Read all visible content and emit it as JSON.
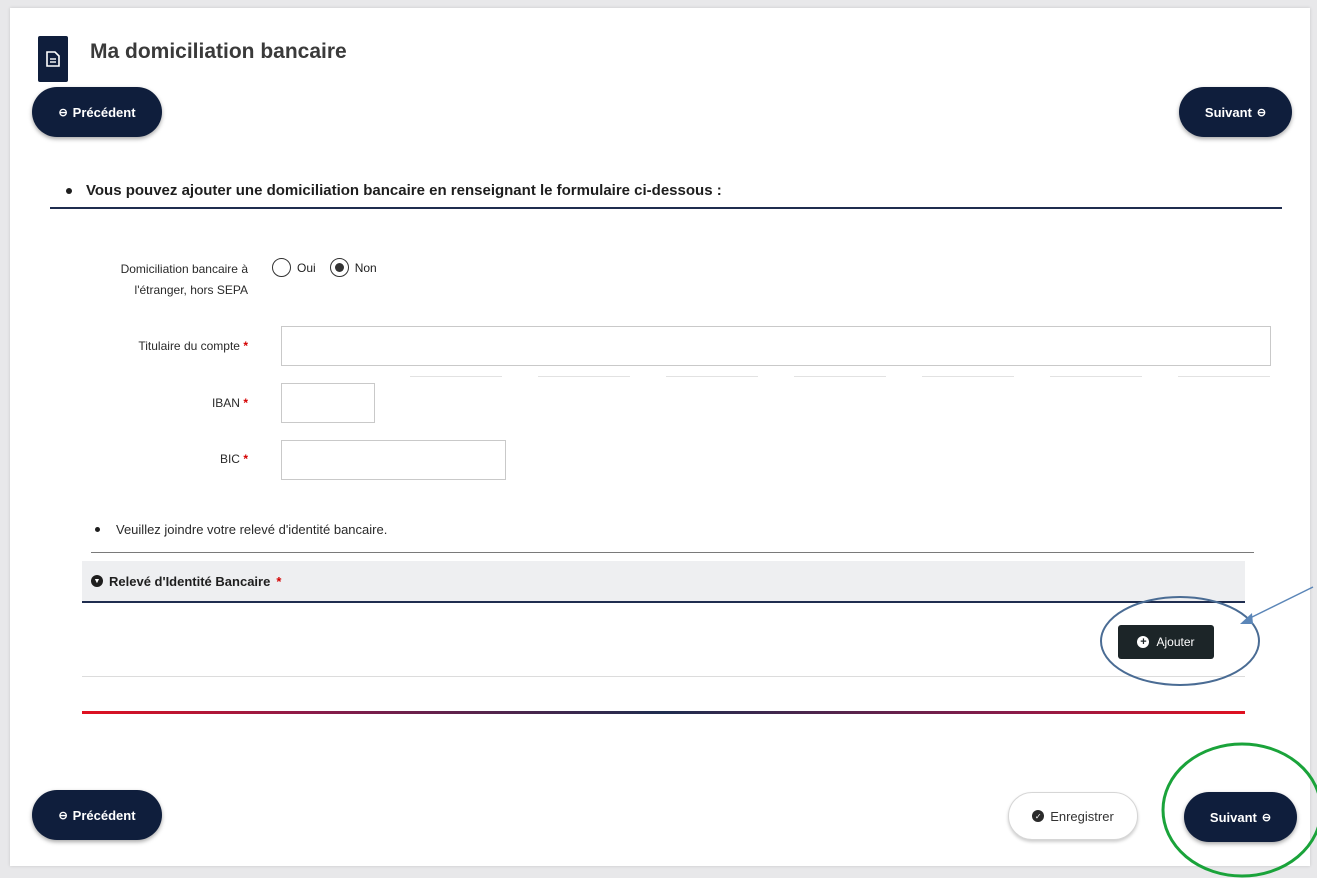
{
  "header": {
    "title": "Ma domiciliation bancaire",
    "icon": "document-icon"
  },
  "nav": {
    "previous_label": "Précédent",
    "next_label": "Suivant"
  },
  "section": {
    "intro": "Vous pouvez ajouter une domiciliation bancaire en renseignant le formulaire ci-dessous :"
  },
  "form": {
    "foreign_label_line1": "Domiciliation bancaire à",
    "foreign_label_line2": "l'étranger, hors SEPA",
    "options": [
      {
        "label": "Oui",
        "selected": false
      },
      {
        "label": "Non",
        "selected": true
      }
    ],
    "holder_label": "Titulaire du compte",
    "holder_value": "",
    "iban_label": "IBAN",
    "iban_value": "",
    "bic_label": "BIC",
    "bic_value": "",
    "required_mark": "*"
  },
  "attachments": {
    "note": "Veuillez joindre votre relevé d'identité bancaire.",
    "panel_title": "Relevé d'Identité Bancaire",
    "add_label": "Ajouter"
  },
  "footer": {
    "save_label": "Enregistrer"
  },
  "colors": {
    "navy": "#0f1e3c",
    "required": "#d40000",
    "annotation_blue": "#4a6c94",
    "annotation_green": "#1aa33a"
  }
}
